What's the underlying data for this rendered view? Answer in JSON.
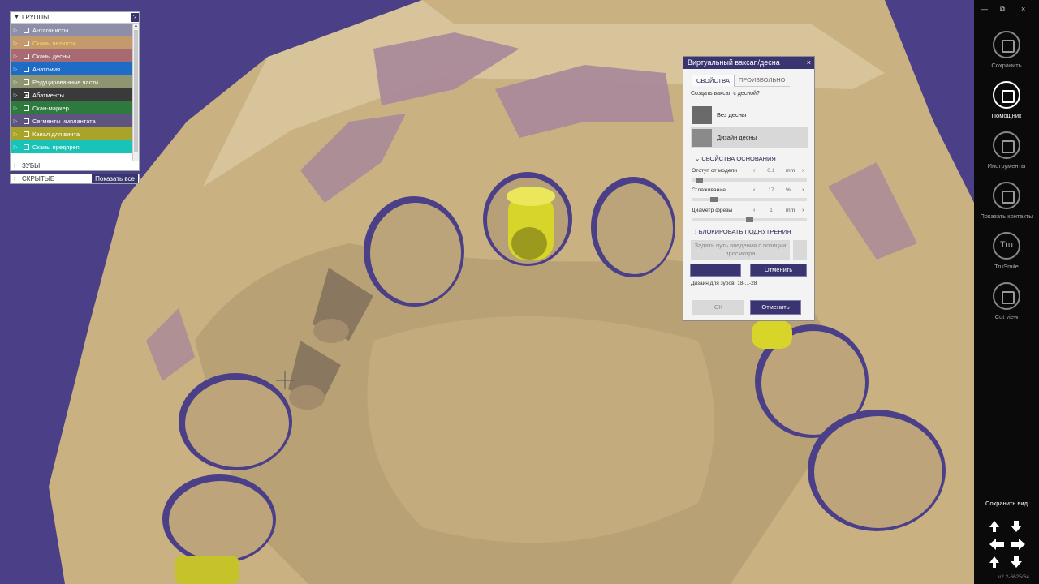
{
  "groups_panel": {
    "title": "ГРУППЫ",
    "help": "?",
    "items": [
      {
        "label": "Антагонисты",
        "color": "#8f8ea8",
        "checked": false,
        "text_color": "#ffffff"
      },
      {
        "label": "Сканы челюсти",
        "color": "#c49a6c",
        "checked": false,
        "text_color": "#f4dd55"
      },
      {
        "label": "Сканы десны",
        "color": "#a86a72",
        "checked": false,
        "text_color": "#ffffff"
      },
      {
        "label": "Анатомия",
        "color": "#1e6cc6",
        "checked": false,
        "text_color": "#ffffff"
      },
      {
        "label": "Редуцированные части",
        "color": "#8d9670",
        "checked": false,
        "text_color": "#ffffff"
      },
      {
        "label": "Абатменты",
        "color": "#3a3a3a",
        "checked": true,
        "text_color": "#ffffff"
      },
      {
        "label": "Скан-маркер",
        "color": "#2e7a3e",
        "checked": false,
        "text_color": "#ffffff"
      },
      {
        "label": "Сегменты имплантата",
        "color": "#5f5480",
        "checked": false,
        "text_color": "#ffffff"
      },
      {
        "label": "Канал для винта",
        "color": "#a9a32a",
        "checked": false,
        "text_color": "#ffffff"
      },
      {
        "label": "Сканы предпреп",
        "color": "#19c3b8",
        "checked": false,
        "text_color": "#ffffff"
      }
    ]
  },
  "teeth_panel": {
    "title": "ЗУБЫ"
  },
  "hidden_panel": {
    "title": "СКРЫТЫЕ",
    "show_all": "Показать все"
  },
  "dialog": {
    "title": "Виртуальный ваксап/десна",
    "close": "×",
    "tabs": [
      "СВОЙСТВА",
      "ПРОИЗВОЛЬНО"
    ],
    "question": "Создать ваксап с десной?",
    "options": [
      "Без десны",
      "Дизайн десны"
    ],
    "base_section": "СВОЙСТВА ОСНОВАНИЯ",
    "params": [
      {
        "label": "Отступ от модели",
        "value": "0.1",
        "unit": "mm",
        "slider": 0.04
      },
      {
        "label": "Сглаживание",
        "value": "17",
        "unit": "%",
        "slider": 0.17
      },
      {
        "label": "Диаметр фрезы",
        "value": "1",
        "unit": "mm",
        "slider": 0.5
      }
    ],
    "undercut_section": "БЛОКИРОВАТЬ ПОДНУТРЕНИЯ",
    "set_path_button": "Задать путь введения с позиции просмотра",
    "cancel_inner": "Отменить",
    "design_for_teeth": "Дизайн для зубов: 18-...-28",
    "ok": "ОК",
    "cancel": "Отменить"
  },
  "toolbar": {
    "window_controls": [
      "—",
      "⧉",
      "×"
    ],
    "tools": [
      {
        "label": "Сохранить",
        "icon": "save-icon",
        "active": false
      },
      {
        "label": "Помощник",
        "icon": "wand-icon",
        "active": true
      },
      {
        "label": "Инструменты",
        "icon": "tools-icon",
        "active": false
      },
      {
        "label": "Показать контакты",
        "icon": "contacts-icon",
        "active": false
      },
      {
        "label": "TruSmile",
        "icon": "trusmile-icon",
        "icon_text": "Tru",
        "active": false
      },
      {
        "label": "Cut view",
        "icon": "cut-view-icon",
        "active": false
      }
    ],
    "save_view": "Сохранить вид",
    "version": "v2.2-6625/64"
  }
}
